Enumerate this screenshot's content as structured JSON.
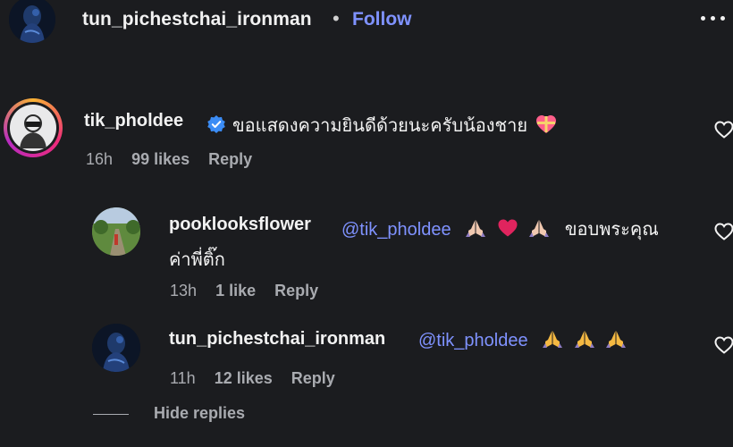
{
  "header": {
    "username": "tun_pichestchai_ironman",
    "separator": "•",
    "follow_label": "Follow",
    "more_icon": "more-options-icon"
  },
  "comments": [
    {
      "username": "tik_pholdee",
      "verified": true,
      "text": "ขอแสดงความยินดีด้วยนะครับน้องชาย",
      "emoji": "heart-gift-emoji",
      "time": "16h",
      "likes": "99 likes",
      "reply_label": "Reply"
    }
  ],
  "replies": [
    {
      "username": "pooklooksflower",
      "mention": "@tik_pholdee",
      "text_line1": "ขอบพระคุณ",
      "text_line2": "ค่าพี่ติ๊ก",
      "emojis": [
        "praying-hands-emoji",
        "red-heart-emoji",
        "praying-hands-emoji"
      ],
      "time": "13h",
      "likes": "1 like",
      "reply_label": "Reply"
    },
    {
      "username": "tun_pichestchai_ironman",
      "mention": "@tik_pholdee",
      "emojis": [
        "praying-hands-emoji",
        "praying-hands-emoji",
        "praying-hands-emoji"
      ],
      "time": "11h",
      "likes": "12 likes",
      "reply_label": "Reply"
    }
  ],
  "hide_replies_label": "Hide replies",
  "colors": {
    "background": "#1b1c1f",
    "accent_link": "#7f92ff",
    "verified_blue": "#3b8cf5",
    "meta_text": "#a9abb0"
  }
}
